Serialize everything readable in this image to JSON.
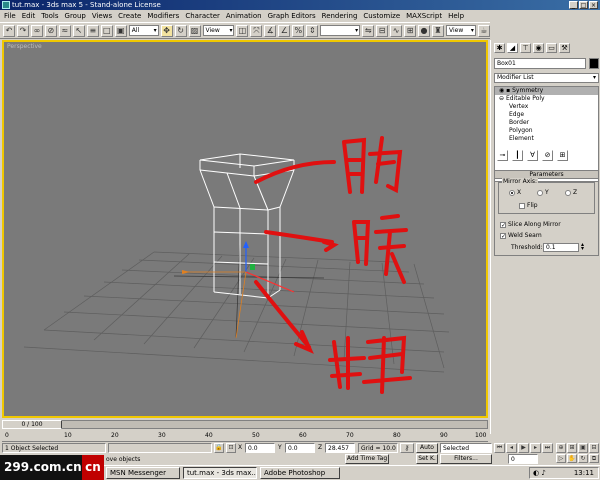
{
  "window": {
    "title": "tut.max - 3ds max 5 - Stand-alone License"
  },
  "menu": [
    "File",
    "Edit",
    "Tools",
    "Group",
    "Views",
    "Create",
    "Modifiers",
    "Character",
    "Animation",
    "Graph Editors",
    "Rendering",
    "Customize",
    "MAXScript",
    "Help"
  ],
  "toolbar": {
    "selection_filter": "All",
    "ref_coord": "View",
    "view_combo": "View",
    "named_sets": "",
    "icons": [
      "undo-icon",
      "redo-icon",
      "link-icon",
      "unlink-icon",
      "bind-space-warp-icon",
      "select-icon",
      "select-by-name-icon",
      "rect-region-icon",
      "window-crossing-icon",
      "select-move-icon",
      "select-rotate-icon",
      "select-scale-icon",
      "pivot-icon",
      "manipulate-icon",
      "snap-icon",
      "angle-snap-icon",
      "percent-snap-icon",
      "spinner-snap-icon",
      "mirror-icon",
      "align-icon",
      "curve-editor-icon",
      "schematic-icon",
      "material-editor-icon",
      "render-scene-icon",
      "quick-render-icon"
    ]
  },
  "viewport": {
    "label": "Perspective",
    "annotations_color": "#e01010"
  },
  "command_panel": {
    "object_name": "Box01",
    "modifier_list": "Modifier List",
    "stack": [
      {
        "label": "Symmetry",
        "selected": true,
        "level": 0
      },
      {
        "label": "Editable Poly",
        "selected": false,
        "level": 0
      },
      {
        "label": "Vertex",
        "selected": false,
        "level": 1
      },
      {
        "label": "Edge",
        "selected": false,
        "level": 1
      },
      {
        "label": "Border",
        "selected": false,
        "level": 1
      },
      {
        "label": "Polygon",
        "selected": false,
        "level": 1
      },
      {
        "label": "Element",
        "selected": false,
        "level": 1
      }
    ],
    "parameters": {
      "title": "Parameters",
      "mirror_axis_label": "Mirror Axis:",
      "axis_x": "X",
      "axis_y": "Y",
      "axis_z": "Z",
      "selected_axis": "X",
      "flip_label": "Flip",
      "flip_checked": false,
      "slice_label": "Slice Along Mirror",
      "slice_checked": true,
      "weld_label": "Weld Seam",
      "weld_checked": true,
      "threshold_label": "Threshold:",
      "threshold_value": "0.1"
    }
  },
  "timeline": {
    "frame_display": "0 / 100",
    "ticks": [
      "0",
      "10",
      "20",
      "30",
      "40",
      "50",
      "60",
      "70",
      "80",
      "90",
      "100"
    ]
  },
  "status": {
    "selection": "1 Object Selected",
    "prompt": "ove objects",
    "x_label": "X",
    "x_value": "0.0",
    "y_label": "Y",
    "y_value": "0.0",
    "z_label": "Z",
    "z_value": "28.457",
    "grid": "Grid = 10.0",
    "add_time_tag": "Add Time Tag",
    "auto_key": "Auto",
    "set_key": "Set K.",
    "key_mode": "Selected",
    "filters": "Filters...",
    "frame": "0"
  },
  "taskbar": {
    "watermark": "299.com.cn",
    "watermark_cn": "cn",
    "items": [
      {
        "label": "MSN Messenger",
        "active": false
      },
      {
        "label": "tut.max - 3ds max...",
        "active": true
      },
      {
        "label": "Adobe Photoshop",
        "active": false
      }
    ],
    "clock": "13:11"
  }
}
